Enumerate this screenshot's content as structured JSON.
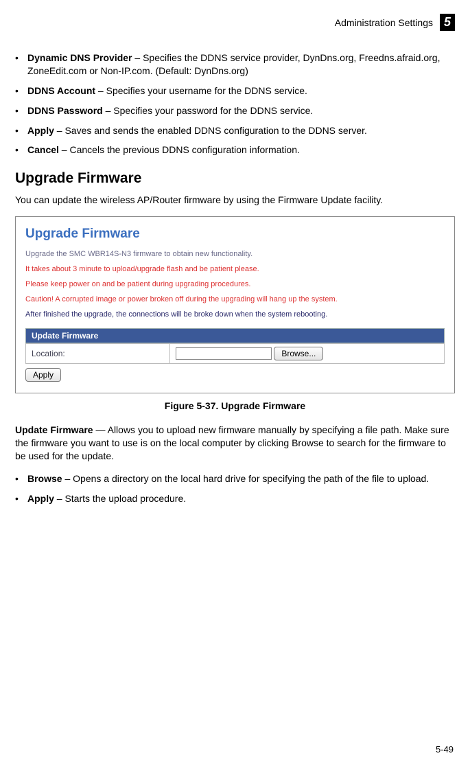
{
  "header": {
    "section_title": "Administration Settings",
    "chapter_number": "5"
  },
  "ddns_items": [
    {
      "term": "Dynamic DNS Provider",
      "desc": " – Specifies the DDNS service provider, DynDns.org, Freedns.afraid.org, ZoneEdit.com or Non-IP.com. (Default: DynDns.org)"
    },
    {
      "term": "DDNS Account",
      "desc": " – Specifies your username for the DDNS service."
    },
    {
      "term": "DDNS Password",
      "desc": " – Specifies your password for the DDNS service."
    },
    {
      "term": "Apply",
      "desc": " – Saves and sends the enabled DDNS configuration to the DDNS server."
    },
    {
      "term": "Cancel",
      "desc": " – Cancels the previous DDNS configuration information."
    }
  ],
  "section": {
    "heading": "Upgrade Firmware",
    "intro": "You can update the wireless AP/Router firmware by using the Firmware Update facility."
  },
  "screenshot": {
    "title": "Upgrade Firmware",
    "msg1": "Upgrade the SMC WBR14S-N3 firmware to obtain new functionality.",
    "msg2": "It takes about 3 minute to upload/upgrade flash and be patient please.",
    "msg3": "Please keep power on and be patient during upgrading procedures.",
    "msg4": "Caution! A corrupted image or power broken off during the upgrading will hang up the system.",
    "msg5": "After finished the upgrade, the connections will be broke down when the system rebooting.",
    "section_bar": "Update Firmware",
    "location_label": "Location:",
    "browse_label": "Browse...",
    "apply_label": "Apply"
  },
  "figure_caption": "Figure 5-37.   Upgrade Firmware",
  "update_firmware": {
    "term": "Update Firmware",
    "desc": " — Allows you to upload new firmware manually by specifying a file path. Make sure the firmware you want to use is on the local computer by clicking Browse to search for the firmware to be used for the update."
  },
  "post_items": [
    {
      "term": "Browse",
      "desc": " – Opens a directory on the local hard drive for specifying the path of the file to upload."
    },
    {
      "term": "Apply",
      "desc": " – Starts the upload procedure."
    }
  ],
  "page_number": "5-49"
}
